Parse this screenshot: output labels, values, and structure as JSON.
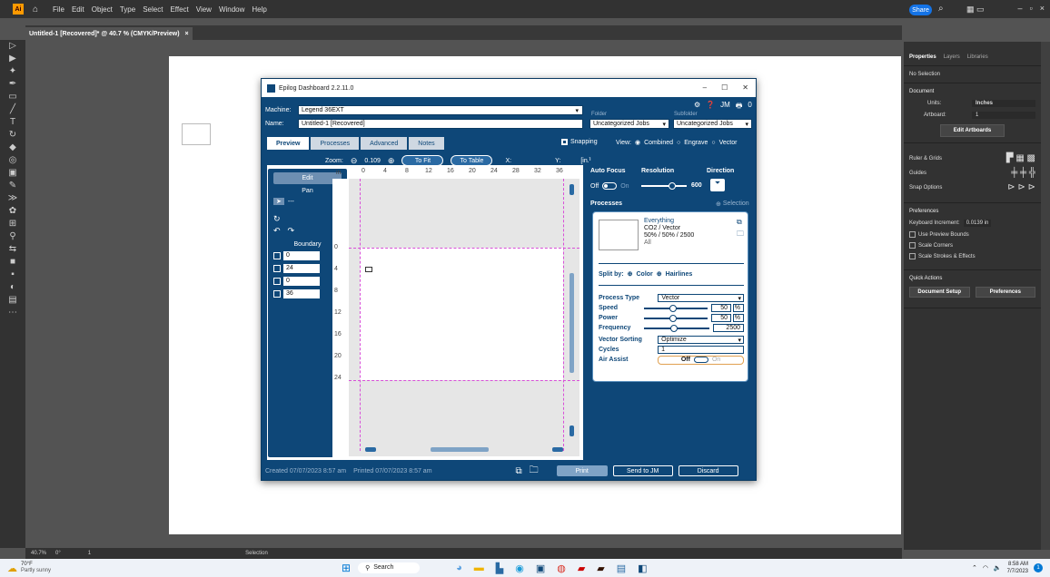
{
  "app": {
    "menu": [
      "File",
      "Edit",
      "Object",
      "Type",
      "Select",
      "Effect",
      "View",
      "Window",
      "Help"
    ],
    "share_label": "Share",
    "doc_tab": "Untitled-1 [Recovered]* @ 40.7 % (CMYK/Preview)",
    "doc_tab_close": "×",
    "statusbar": {
      "zoom": "40.7%",
      "rotate": "0°",
      "artboard": "1",
      "tool": "Selection"
    }
  },
  "panel": {
    "tabs": [
      "Properties",
      "Layers",
      "Libraries"
    ],
    "no_selection": "No Selection",
    "document_h": "Document",
    "units_label": "Units:",
    "units_value": "Inches",
    "artboard_label": "Artboard:",
    "artboard_value": "1",
    "edit_artboards": "Edit Artboards",
    "ruler_grids": "Ruler & Grids",
    "guides": "Guides",
    "snap_options": "Snap Options",
    "preferences_h": "Preferences",
    "kb_increment_label": "Keyboard Increment:",
    "kb_increment_value": "0.0139 in",
    "checks": [
      "Use Preview Bounds",
      "Scale Corners",
      "Scale Strokes & Effects"
    ],
    "quick_actions": "Quick Actions",
    "doc_setup": "Document Setup",
    "prefs_btn": "Preferences"
  },
  "epilog": {
    "title": "Epilog Dashboard 2.2.11.0",
    "jobs_count": "0",
    "machine_label": "Machine:",
    "machine_value": "Legend 36EXT",
    "name_label": "Name:",
    "name_value": "Untitled-1 [Recovered]",
    "folder_label": "Folder",
    "folder_value": "Uncategorized Jobs",
    "subfolder_label": "Subfolder",
    "subfolder_value": "Uncategorized Jobs",
    "tabs": [
      "Preview",
      "Processes",
      "Advanced",
      "Notes"
    ],
    "snapping": "Snapping",
    "view_label": "View:",
    "view_options": [
      "Combined",
      "Engrave",
      "Vector"
    ],
    "zoom_label": "Zoom:",
    "zoom_value": "0.109",
    "to_fit": "To Fit",
    "to_table": "To Table",
    "x_label": "X:",
    "y_label": "Y:",
    "units": "[in.]",
    "ruler_unit": "in.",
    "ruler_x": [
      "0",
      "4",
      "8",
      "12",
      "16",
      "20",
      "24",
      "28",
      "32",
      "36"
    ],
    "ruler_y": [
      "0",
      "4",
      "8",
      "12",
      "16",
      "20",
      "24"
    ],
    "side": {
      "edit": "Edit",
      "pan": "Pan",
      "boundary": "Boundary",
      "values": [
        "0",
        "24",
        "0",
        "36"
      ]
    },
    "auto_focus": "Auto Focus",
    "af_off": "Off",
    "af_on": "On",
    "resolution": "Resolution",
    "res_value": "600",
    "direction": "Direction",
    "processes": "Processes",
    "selection": "Selection",
    "card": {
      "name": "Everything",
      "type": "CO2 / Vector",
      "settings": "50% / 50% / 2500",
      "scope": "All",
      "split_by": "Split by:",
      "color": "Color",
      "hairlines": "Hairlines",
      "process_type_label": "Process Type",
      "process_type": "Vector",
      "speed_label": "Speed",
      "speed": "50",
      "power_label": "Power",
      "power": "50",
      "pct": "%",
      "frequency_label": "Frequency",
      "frequency": "2500",
      "vs_label": "Vector Sorting",
      "vs_value": "Optimize",
      "cycles_label": "Cycles",
      "cycles": "1",
      "air_label": "Air Assist",
      "air_off": "Off",
      "air_on": "On"
    },
    "created": "Created 07/07/2023 8:57 am",
    "printed": "Printed 07/07/2023 8:57 am",
    "print": "Print",
    "send_jm": "Send to JM",
    "discard": "Discard"
  },
  "taskbar": {
    "temp": "70°F",
    "weather": "Partly sunny",
    "search": "Search",
    "time": "8:58 AM",
    "date": "7/7/2023"
  }
}
